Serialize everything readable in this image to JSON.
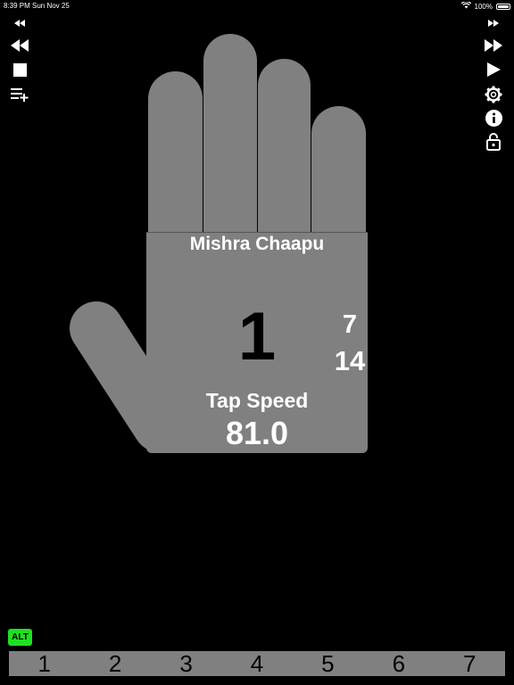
{
  "status_bar": {
    "time": "8:39 PM",
    "date": "Sun Nov 25",
    "battery": "100%"
  },
  "tala": {
    "name": "Mishra Chaapu",
    "current_beat": "1",
    "count_top": "7",
    "count_bottom": "14",
    "tap_speed_label": "Tap Speed",
    "tap_speed_value": "81.0"
  },
  "alt_button": {
    "label": "ALT",
    "color": "#1fe01f"
  },
  "beat_strip": {
    "beats": [
      "1",
      "2",
      "3",
      "4",
      "5",
      "6",
      "7"
    ]
  },
  "colors": {
    "background": "#000000",
    "hand": "#808080"
  },
  "left_controls": [
    "skip-back-small-icon",
    "rewind-icon",
    "stop-icon",
    "add-playlist-icon"
  ],
  "right_controls": [
    "skip-forward-small-icon",
    "fast-forward-icon",
    "play-icon",
    "gear-icon",
    "info-icon",
    "lock-icon"
  ]
}
